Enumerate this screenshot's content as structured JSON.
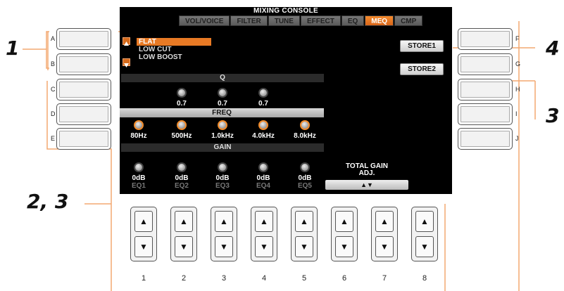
{
  "screen": {
    "title": "MIXING CONSOLE",
    "tabs": [
      "VOL/VOICE",
      "FILTER",
      "TUNE",
      "EFFECT",
      "EQ",
      "MEQ",
      "CMP"
    ],
    "active_tab": "MEQ"
  },
  "preset_menu": [
    "FLAT",
    "LOW CUT",
    "LOW BOOST"
  ],
  "store_buttons": [
    "STORE1",
    "STORE2"
  ],
  "sections": {
    "q": "Q",
    "freq": "FREQ",
    "gain": "GAIN"
  },
  "q_values": [
    "0.7",
    "0.7",
    "0.7"
  ],
  "freq_values": [
    "80Hz",
    "500Hz",
    "1.0kHz",
    "4.0kHz",
    "8.0kHz"
  ],
  "gain_values": [
    "0dB",
    "0dB",
    "0dB",
    "0dB",
    "0dB"
  ],
  "eq_labels": [
    "EQ1",
    "EQ2",
    "EQ3",
    "EQ4",
    "EQ5"
  ],
  "total_gain": {
    "line1": "TOTAL GAIN",
    "line2": "ADJ.",
    "arrows": "▲▼"
  },
  "left_buttons": [
    "A",
    "B",
    "C",
    "D",
    "E"
  ],
  "right_buttons": [
    "F",
    "G",
    "H",
    "I",
    "J"
  ],
  "bottom_buttons": [
    "1",
    "2",
    "3",
    "4",
    "5",
    "6",
    "7",
    "8"
  ],
  "bottom_arrows": {
    "up": "▲",
    "down": "▼"
  },
  "callouts": {
    "c1": "1",
    "c23": "2, 3",
    "c3": "3",
    "c4": "4"
  },
  "colors": {
    "accent": "#e87a25",
    "screen_bg": "#000000",
    "callout_line": "#f3a870"
  }
}
